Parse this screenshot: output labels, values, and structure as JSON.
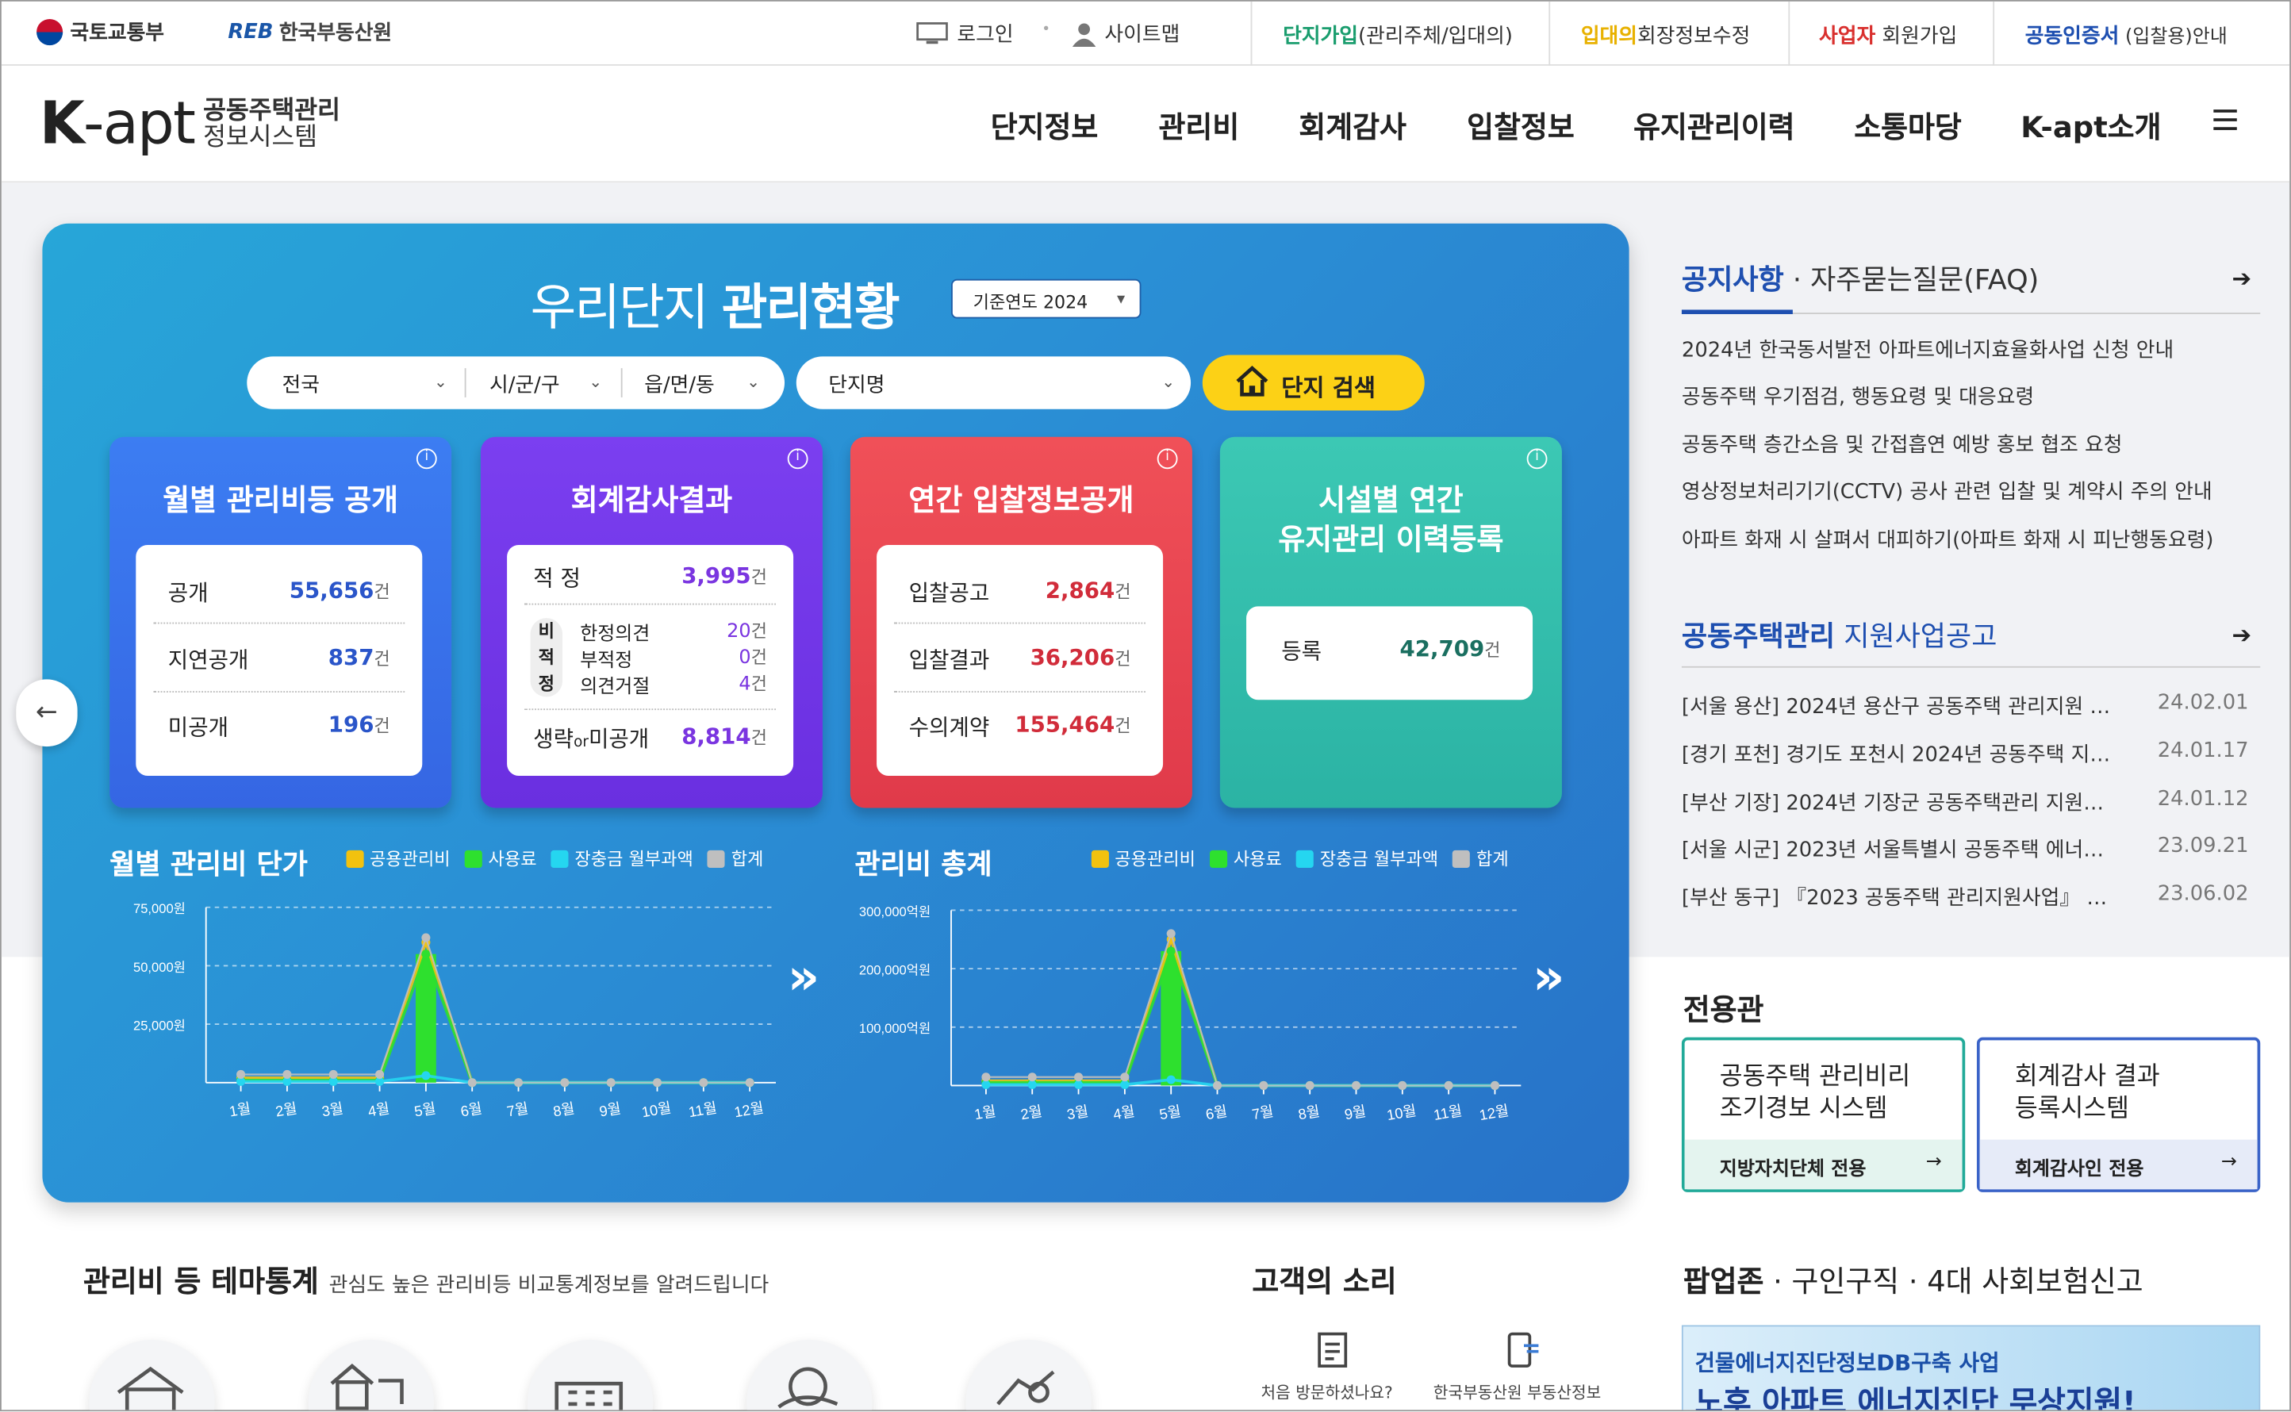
{
  "util": {
    "molit": "국토교통부",
    "reb_logo": "REB",
    "reb_name": "한국부동산원",
    "login": "로그인",
    "sitemap": "사이트맵",
    "join_complex_hl": "단지가입",
    "join_complex_rest": "(관리주체/입대의)",
    "resident_hl": "입대의",
    "resident_rest": "회장정보수정",
    "biz_hl": "사업자",
    "biz_rest": " 회원가입",
    "cert_hl": "공동인증서",
    "cert_rest": " (입찰용)안내"
  },
  "brand": {
    "k": "K",
    "apt": "-apt",
    "line1": "공동주택관리",
    "line2": "정보시스템"
  },
  "gnb": [
    "단지정보",
    "관리비",
    "회계감사",
    "입찰정보",
    "유지관리이력",
    "소통마당",
    "K-apt소개"
  ],
  "panel": {
    "title_light": "우리단지 ",
    "title_bold": "관리현황",
    "year": "기준연도 2024",
    "sel_nation": "전국",
    "sel_city": "시/군/구",
    "sel_town": "읍/면/동",
    "sel_complex": "단지명",
    "search": "단지 검색"
  },
  "cards": {
    "mgmt": {
      "title": "월별 관리비등 공개",
      "rows": [
        {
          "k": "공개",
          "v": "55,656"
        },
        {
          "k": "지연공개",
          "v": "837"
        },
        {
          "k": "미공개",
          "v": "196"
        }
      ],
      "unit": "건"
    },
    "audit": {
      "title": "회계감사결과",
      "ok_label": "적 정",
      "ok_val": "3,995",
      "nonok": "비\n적\n정",
      "sub": [
        {
          "k": "한정의견",
          "v": "20"
        },
        {
          "k": "부적정",
          "v": "0"
        },
        {
          "k": "의견거절",
          "v": "4"
        }
      ],
      "omit_a": "생략",
      "omit_or": "or",
      "omit_b": "미공개",
      "omit_val": "8,814",
      "unit": "건"
    },
    "bid": {
      "title": "연간 입찰정보공개",
      "rows": [
        {
          "k": "입찰공고",
          "v": "2,864"
        },
        {
          "k": "입찰결과",
          "v": "36,206"
        },
        {
          "k": "수의계약",
          "v": "155,464"
        }
      ],
      "unit": "건"
    },
    "facility": {
      "title1": "시설별 연간",
      "title2": "유지관리 이력등록",
      "k": "등록",
      "v": "42,709",
      "unit": "건"
    }
  },
  "chart_data": [
    {
      "type": "line",
      "title": "월별 관리비 단가",
      "categories": [
        "1월",
        "2월",
        "3월",
        "4월",
        "5월",
        "6월",
        "7월",
        "8월",
        "9월",
        "10월",
        "11월",
        "12월"
      ],
      "yticks": [
        "75,000원",
        "50,000원",
        "25,000원"
      ],
      "ylim": [
        0,
        75000
      ],
      "series": [
        {
          "name": "공용관리비",
          "values": [
            2000,
            2000,
            2000,
            2000,
            60000,
            0,
            0,
            0,
            0,
            0,
            0,
            0
          ]
        },
        {
          "name": "사용료",
          "values": [
            1000,
            1000,
            1000,
            1000,
            55000,
            0,
            0,
            0,
            0,
            0,
            0,
            0
          ]
        },
        {
          "name": "장충금 월부과액",
          "values": [
            500,
            500,
            500,
            500,
            3000,
            0,
            0,
            0,
            0,
            0,
            0,
            0
          ]
        },
        {
          "name": "합계",
          "values": [
            3500,
            3500,
            3500,
            3500,
            62000,
            0,
            0,
            0,
            0,
            0,
            0,
            0
          ]
        }
      ]
    },
    {
      "type": "line",
      "title": "관리비 총계",
      "categories": [
        "1월",
        "2월",
        "3월",
        "4월",
        "5월",
        "6월",
        "7월",
        "8월",
        "9월",
        "10월",
        "11월",
        "12월"
      ],
      "yticks": [
        "300,000억원",
        "200,000억원",
        "100,000억원"
      ],
      "ylim": [
        0,
        300000
      ],
      "series": [
        {
          "name": "공용관리비",
          "values": [
            8000,
            8000,
            8000,
            8000,
            250000,
            0,
            0,
            0,
            0,
            0,
            0,
            0
          ]
        },
        {
          "name": "사용료",
          "values": [
            5000,
            5000,
            5000,
            5000,
            230000,
            0,
            0,
            0,
            0,
            0,
            0,
            0
          ]
        },
        {
          "name": "장충금 월부과액",
          "values": [
            1500,
            1500,
            1500,
            1500,
            10000,
            0,
            0,
            0,
            0,
            0,
            0,
            0
          ]
        },
        {
          "name": "합계",
          "values": [
            14500,
            14500,
            14500,
            14500,
            260000,
            0,
            0,
            0,
            0,
            0,
            0,
            0
          ]
        }
      ]
    }
  ],
  "legend_colors": [
    "#f2c20f",
    "#2ee02e",
    "#25d6f0",
    "#bfbfbf"
  ],
  "notice": {
    "hl": "공지사항",
    "rest": " · 자주묻는질문(FAQ)",
    "items": [
      "2024년 한국동서발전 아파트에너지효율화사업 신청 안내",
      "공동주택 우기점검, 행동요령 및 대응요령",
      "공동주택 층간소음 및 간접흡연 예방 홍보 협조 요청",
      "영상정보처리기기(CCTV) 공사 관련 입찰 및 계약시 주의 안내",
      "아파트 화재 시 살펴서 대피하기(아파트 화재 시 피난행동요령)"
    ]
  },
  "support": {
    "hl": "공동주택관리",
    "rest": " 지원사업공고",
    "items": [
      {
        "t": "[서울 용산] 2024년 용산구 공동주택 관리지원 …",
        "d": "24.02.01"
      },
      {
        "t": "[경기 포천] 경기도 포천시 2024년 공동주택 지…",
        "d": "24.01.17"
      },
      {
        "t": "[부산 기장] 2024년 기장군 공동주택관리 지원…",
        "d": "24.01.12"
      },
      {
        "t": "[서울 시군] 2023년 서울특별시 공동주택 에너…",
        "d": "23.09.21"
      },
      {
        "t": "[부산 동구] 『2023 공동주택 관리지원사업』 …",
        "d": "23.06.02"
      }
    ]
  },
  "special": {
    "title": "전용관",
    "b1_l1": "공동주택 관리비리",
    "b1_l2": "조기경보 시스템",
    "b1_f": "지방자치단체 전용",
    "b2_l1": "회계감사 결과",
    "b2_l2": "등록시스템",
    "b2_f": "회계감사인 전용"
  },
  "bottom": {
    "theme_title": "관리비 등 테마통계",
    "theme_desc": "관심도 높은 관리비등 비교통계정보를 알려드립니다",
    "voice_title": "고객의 소리",
    "voice1": "처음 방문하셨나요?",
    "voice2": "한국부동산원 부동산정보",
    "popup_hl": "팝업존",
    "popup_rest": " · 구인구직 · 4대 사회보험신고",
    "banner1": "건물에너지진단정보DB구축 사업",
    "banner2": "노후 아파트 에너지진단 무상지원!"
  }
}
